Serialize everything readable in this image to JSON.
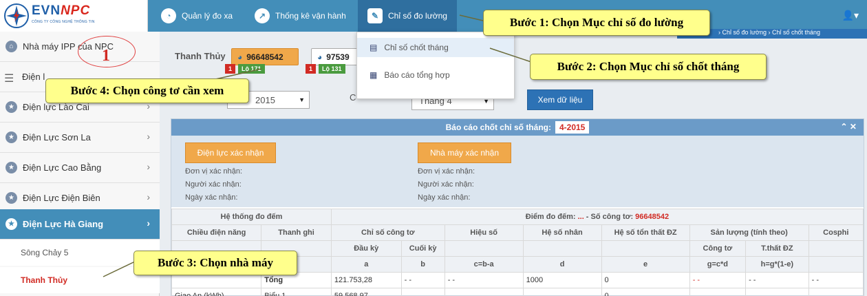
{
  "brand": {
    "name_a": "EVN",
    "name_b": "NPC",
    "tagline": "CÔNG TY CÔNG NGHỆ THÔNG TIN"
  },
  "nav": {
    "items": [
      {
        "label": "Quản lý đo xa",
        "icon": "dashboard-icon"
      },
      {
        "label": "Thống kê vận hành",
        "icon": "chart-icon"
      },
      {
        "label": "Chỉ số đo lường",
        "icon": "edit-icon"
      }
    ],
    "user_icon": "user-icon"
  },
  "sidebar": {
    "home": "Nhà máy IPP của NPC",
    "items": [
      "Điện l",
      "Điện lực Lào Cai",
      "Điện Lực Sơn La",
      "Điện Lực Cao Bằng",
      "Điện Lực Điện Biên",
      "Điện Lực Hà Giang"
    ],
    "subs": [
      "Sông Chảy 5",
      "Thanh Thủy"
    ]
  },
  "dropdown": {
    "items": [
      "Chỉ số chốt tháng",
      "Báo cáo tổng hợp"
    ]
  },
  "right_bar": "› Chỉ số đo lường › Chỉ số chốt tháng",
  "main": {
    "plant": "Thanh Thủy",
    "meters": [
      {
        "id": "96648542",
        "tag_n": "1",
        "tag": "Lộ 171"
      },
      {
        "id": "97539",
        "tag_n": "1",
        "tag": "Lộ 131"
      }
    ],
    "year": "2015",
    "filter_c": "C",
    "month": "Tháng 4",
    "view_button": "Xem dữ liệu"
  },
  "panel": {
    "title": "Báo cáo chốt chỉ số tháng:",
    "period": "4-2015",
    "tools": "⌃ ✕",
    "btn_dl": "Điện lực xác nhận",
    "btn_nm": "Nhà máy xác nhận",
    "lines": [
      "Đơn vị xác nhận:",
      "Người xác nhận:",
      "Ngày xác nhận:"
    ]
  },
  "table": {
    "h_system": "Hệ thống đo đếm",
    "h_point_a": "Điểm đo đếm: ",
    "h_point_dots": "...",
    "h_point_b": " - Số công tơ: ",
    "h_point_meter": "96648542",
    "h_cols": [
      "Chiều điện năng",
      "Thanh ghi",
      "Chỉ số công tơ",
      "Hiệu số",
      "Hệ số nhân",
      "Hệ số tổn thất ĐZ",
      "Sản lượng (tính theo)",
      "Cosphi"
    ],
    "h_sub": [
      "Đầu kỳ",
      "Cuối kỳ",
      "Công tơ",
      "T.thất ĐZ"
    ],
    "h_letters": [
      "a",
      "b",
      "c=b-a",
      "d",
      "e",
      "g=c*d",
      "h=g*(1-e)"
    ],
    "row1": {
      "reg": "Tổng",
      "start": "121.753,28",
      "end": "- -",
      "diff": "- -",
      "mult": "1000",
      "loss": "0",
      "out": "- -",
      "outl": "- -",
      "cos": "- -"
    },
    "row2": {
      "dir": "Giao An (kWh)",
      "reg": "Biểu 1",
      "start": "59.568,97",
      "loss": "0"
    }
  },
  "callouts": {
    "c1": "Bước 1: Chọn Mục chỉ số đo lường",
    "c2": "Bước 2: Chọn Mục chỉ số chốt tháng",
    "c3": "Bước 3: Chọn nhà máy",
    "c4": "Bước 4: Chọn công tơ cần xem",
    "marker": "1"
  }
}
